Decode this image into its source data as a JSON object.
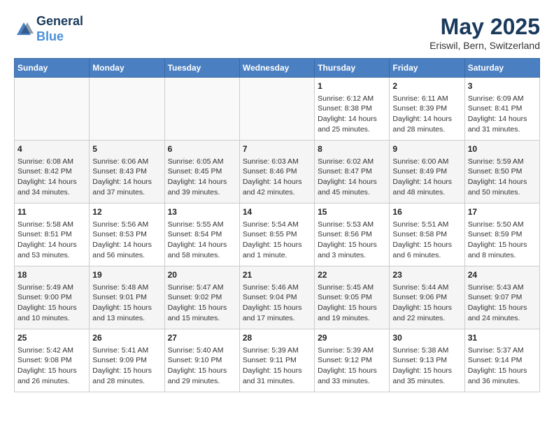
{
  "header": {
    "logo_line1": "General",
    "logo_line2": "Blue",
    "title": "May 2025",
    "subtitle": "Eriswil, Bern, Switzerland"
  },
  "days_of_week": [
    "Sunday",
    "Monday",
    "Tuesday",
    "Wednesday",
    "Thursday",
    "Friday",
    "Saturday"
  ],
  "weeks": [
    [
      {
        "num": "",
        "content": ""
      },
      {
        "num": "",
        "content": ""
      },
      {
        "num": "",
        "content": ""
      },
      {
        "num": "",
        "content": ""
      },
      {
        "num": "1",
        "content": "Sunrise: 6:12 AM\nSunset: 8:38 PM\nDaylight: 14 hours and 25 minutes."
      },
      {
        "num": "2",
        "content": "Sunrise: 6:11 AM\nSunset: 8:39 PM\nDaylight: 14 hours and 28 minutes."
      },
      {
        "num": "3",
        "content": "Sunrise: 6:09 AM\nSunset: 8:41 PM\nDaylight: 14 hours and 31 minutes."
      }
    ],
    [
      {
        "num": "4",
        "content": "Sunrise: 6:08 AM\nSunset: 8:42 PM\nDaylight: 14 hours and 34 minutes."
      },
      {
        "num": "5",
        "content": "Sunrise: 6:06 AM\nSunset: 8:43 PM\nDaylight: 14 hours and 37 minutes."
      },
      {
        "num": "6",
        "content": "Sunrise: 6:05 AM\nSunset: 8:45 PM\nDaylight: 14 hours and 39 minutes."
      },
      {
        "num": "7",
        "content": "Sunrise: 6:03 AM\nSunset: 8:46 PM\nDaylight: 14 hours and 42 minutes."
      },
      {
        "num": "8",
        "content": "Sunrise: 6:02 AM\nSunset: 8:47 PM\nDaylight: 14 hours and 45 minutes."
      },
      {
        "num": "9",
        "content": "Sunrise: 6:00 AM\nSunset: 8:49 PM\nDaylight: 14 hours and 48 minutes."
      },
      {
        "num": "10",
        "content": "Sunrise: 5:59 AM\nSunset: 8:50 PM\nDaylight: 14 hours and 50 minutes."
      }
    ],
    [
      {
        "num": "11",
        "content": "Sunrise: 5:58 AM\nSunset: 8:51 PM\nDaylight: 14 hours and 53 minutes."
      },
      {
        "num": "12",
        "content": "Sunrise: 5:56 AM\nSunset: 8:53 PM\nDaylight: 14 hours and 56 minutes."
      },
      {
        "num": "13",
        "content": "Sunrise: 5:55 AM\nSunset: 8:54 PM\nDaylight: 14 hours and 58 minutes."
      },
      {
        "num": "14",
        "content": "Sunrise: 5:54 AM\nSunset: 8:55 PM\nDaylight: 15 hours and 1 minute."
      },
      {
        "num": "15",
        "content": "Sunrise: 5:53 AM\nSunset: 8:56 PM\nDaylight: 15 hours and 3 minutes."
      },
      {
        "num": "16",
        "content": "Sunrise: 5:51 AM\nSunset: 8:58 PM\nDaylight: 15 hours and 6 minutes."
      },
      {
        "num": "17",
        "content": "Sunrise: 5:50 AM\nSunset: 8:59 PM\nDaylight: 15 hours and 8 minutes."
      }
    ],
    [
      {
        "num": "18",
        "content": "Sunrise: 5:49 AM\nSunset: 9:00 PM\nDaylight: 15 hours and 10 minutes."
      },
      {
        "num": "19",
        "content": "Sunrise: 5:48 AM\nSunset: 9:01 PM\nDaylight: 15 hours and 13 minutes."
      },
      {
        "num": "20",
        "content": "Sunrise: 5:47 AM\nSunset: 9:02 PM\nDaylight: 15 hours and 15 minutes."
      },
      {
        "num": "21",
        "content": "Sunrise: 5:46 AM\nSunset: 9:04 PM\nDaylight: 15 hours and 17 minutes."
      },
      {
        "num": "22",
        "content": "Sunrise: 5:45 AM\nSunset: 9:05 PM\nDaylight: 15 hours and 19 minutes."
      },
      {
        "num": "23",
        "content": "Sunrise: 5:44 AM\nSunset: 9:06 PM\nDaylight: 15 hours and 22 minutes."
      },
      {
        "num": "24",
        "content": "Sunrise: 5:43 AM\nSunset: 9:07 PM\nDaylight: 15 hours and 24 minutes."
      }
    ],
    [
      {
        "num": "25",
        "content": "Sunrise: 5:42 AM\nSunset: 9:08 PM\nDaylight: 15 hours and 26 minutes."
      },
      {
        "num": "26",
        "content": "Sunrise: 5:41 AM\nSunset: 9:09 PM\nDaylight: 15 hours and 28 minutes."
      },
      {
        "num": "27",
        "content": "Sunrise: 5:40 AM\nSunset: 9:10 PM\nDaylight: 15 hours and 29 minutes."
      },
      {
        "num": "28",
        "content": "Sunrise: 5:39 AM\nSunset: 9:11 PM\nDaylight: 15 hours and 31 minutes."
      },
      {
        "num": "29",
        "content": "Sunrise: 5:39 AM\nSunset: 9:12 PM\nDaylight: 15 hours and 33 minutes."
      },
      {
        "num": "30",
        "content": "Sunrise: 5:38 AM\nSunset: 9:13 PM\nDaylight: 15 hours and 35 minutes."
      },
      {
        "num": "31",
        "content": "Sunrise: 5:37 AM\nSunset: 9:14 PM\nDaylight: 15 hours and 36 minutes."
      }
    ]
  ]
}
